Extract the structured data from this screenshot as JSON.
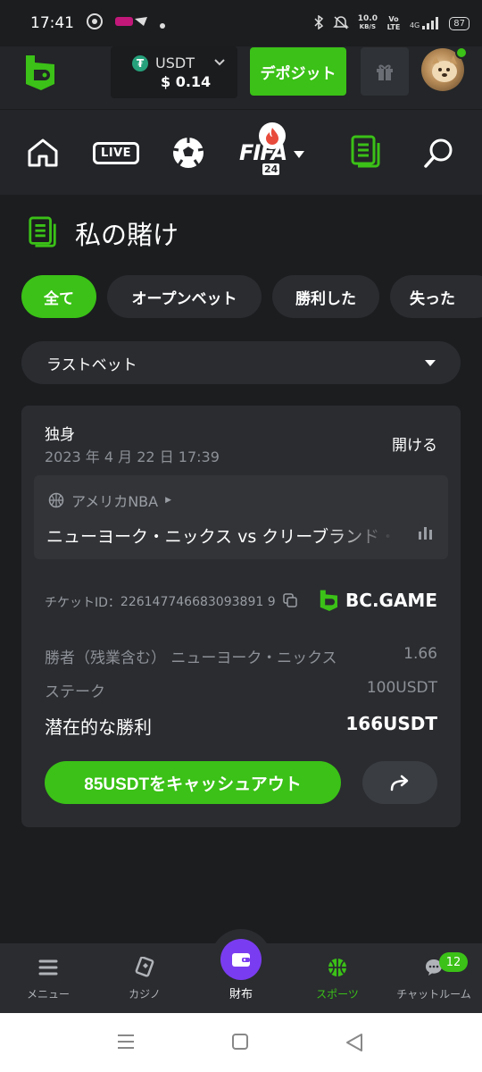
{
  "status_bar": {
    "time": "17:41",
    "net_speed": "10.0",
    "net_unit": "KB/S",
    "volte": "Vo LTE",
    "signal": "4G",
    "battery": "87"
  },
  "header": {
    "balance": {
      "currency": "USDT",
      "amount": "$ 0.14"
    },
    "deposit_label": "デポジット"
  },
  "category_nav": {
    "live_label": "LIVE",
    "fifa_label": "FIFA",
    "fifa_year": "24"
  },
  "page": {
    "title": "私の賭け"
  },
  "tabs": [
    {
      "label": "全て",
      "active": true
    },
    {
      "label": "オープンベット",
      "active": false
    },
    {
      "label": "勝利した",
      "active": false
    },
    {
      "label": "失った",
      "active": false
    }
  ],
  "filter": {
    "selected": "ラストベット"
  },
  "bet": {
    "type": "独身",
    "date": "2023 年 4 月 22 日 17:39",
    "open_label": "開ける",
    "league": "アメリカNBA",
    "match": "ニューヨーク・ニックス vs クリーブランド・キャバリアーズ",
    "ticket_label": "チケットID：",
    "ticket_id": "226147746683093891 9",
    "brand": "BC.GAME",
    "market": "勝者（残業含む） ニューヨーク・ニックス",
    "odds": "1.66",
    "stake_label": "ステーク",
    "stake": "100USDT",
    "potential_label": "潜在的な勝利",
    "potential": "166USDT",
    "cashout_label": "85USDTをキャッシュアウト"
  },
  "bottom_nav": [
    {
      "label": "メニュー",
      "active": false
    },
    {
      "label": "カジノ",
      "active": false
    },
    {
      "label": "財布",
      "active": false
    },
    {
      "label": "スポーツ",
      "active": true
    },
    {
      "label": "チャットルーム",
      "active": false,
      "badge": "12"
    }
  ],
  "colors": {
    "accent": "#3bc117",
    "background": "#1b1d1f",
    "card": "#2a2c30",
    "wallet": "#7a3cf0"
  }
}
